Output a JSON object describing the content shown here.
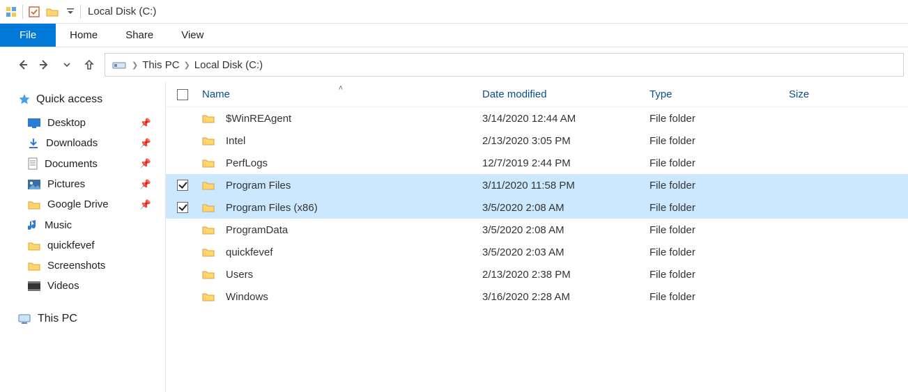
{
  "window_title": "Local Disk (C:)",
  "ribbon": {
    "file": "File",
    "home": "Home",
    "share": "Share",
    "view": "View"
  },
  "breadcrumb": {
    "root": "This PC",
    "current": "Local Disk (C:)"
  },
  "columns": {
    "name": "Name",
    "date": "Date modified",
    "type": "Type",
    "size": "Size"
  },
  "sidebar": {
    "quick_access": "Quick access",
    "items": [
      {
        "label": "Desktop",
        "icon": "desktop",
        "pinned": true
      },
      {
        "label": "Downloads",
        "icon": "download",
        "pinned": true
      },
      {
        "label": "Documents",
        "icon": "document",
        "pinned": true
      },
      {
        "label": "Pictures",
        "icon": "pictures",
        "pinned": true
      },
      {
        "label": "Google Drive",
        "icon": "folder",
        "pinned": true
      },
      {
        "label": "Music",
        "icon": "music",
        "pinned": false
      },
      {
        "label": "quickfevef",
        "icon": "folder",
        "pinned": false
      },
      {
        "label": "Screenshots",
        "icon": "folder",
        "pinned": false
      },
      {
        "label": "Videos",
        "icon": "video",
        "pinned": false
      }
    ],
    "this_pc": "This PC"
  },
  "files": [
    {
      "name": "$WinREAgent",
      "date": "3/14/2020 12:44 AM",
      "type": "File folder",
      "selected": false
    },
    {
      "name": "Intel",
      "date": "2/13/2020 3:05 PM",
      "type": "File folder",
      "selected": false
    },
    {
      "name": "PerfLogs",
      "date": "12/7/2019 2:44 PM",
      "type": "File folder",
      "selected": false
    },
    {
      "name": "Program Files",
      "date": "3/11/2020 11:58 PM",
      "type": "File folder",
      "selected": true
    },
    {
      "name": "Program Files (x86)",
      "date": "3/5/2020 2:08 AM",
      "type": "File folder",
      "selected": true
    },
    {
      "name": "ProgramData",
      "date": "3/5/2020 2:08 AM",
      "type": "File folder",
      "selected": false
    },
    {
      "name": "quickfevef",
      "date": "3/5/2020 2:03 AM",
      "type": "File folder",
      "selected": false
    },
    {
      "name": "Users",
      "date": "2/13/2020 2:38 PM",
      "type": "File folder",
      "selected": false
    },
    {
      "name": "Windows",
      "date": "3/16/2020 2:28 AM",
      "type": "File folder",
      "selected": false
    }
  ]
}
